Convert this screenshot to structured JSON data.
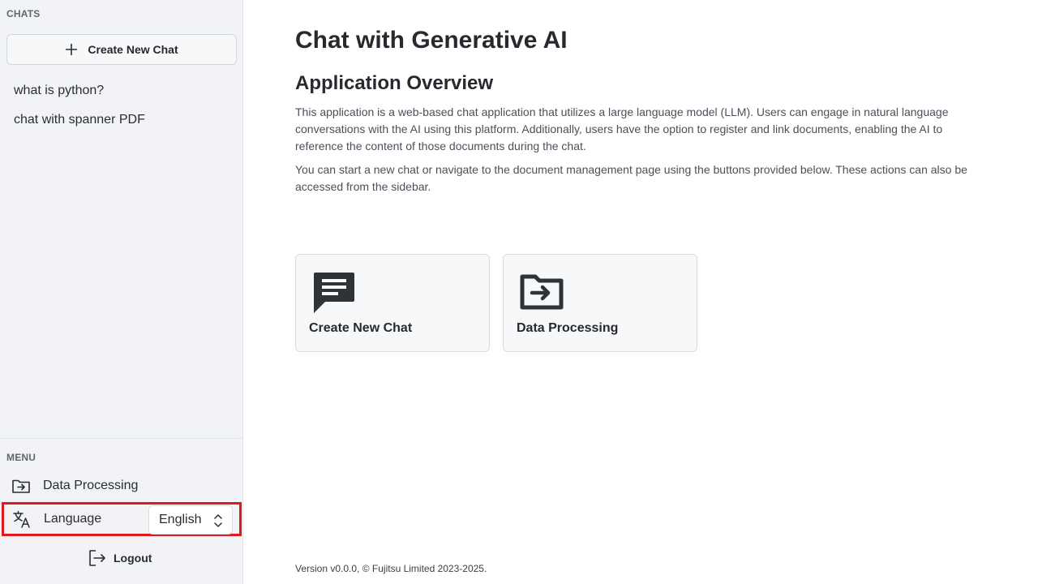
{
  "sidebar": {
    "chats_label": "CHATS",
    "new_chat_label": "Create New Chat",
    "chats": [
      {
        "title": "what is python?"
      },
      {
        "title": "chat with spanner PDF"
      }
    ],
    "menu_label": "MENU",
    "menu": {
      "data_processing_label": "Data Processing",
      "language_label": "Language",
      "language_value": "English",
      "logout_label": "Logout"
    }
  },
  "main": {
    "title": "Chat with Generative AI",
    "overview_title": "Application Overview",
    "paragraph1": "This application is a web-based chat application that utilizes a large language model (LLM). Users can engage in natural language conversations with the AI using this platform. Additionally, users have the option to register and link documents, enabling the AI to reference the content of those documents during the chat.",
    "paragraph2": "You can start a new chat or navigate to the document management page using the buttons provided below. These actions can also be accessed from the sidebar.",
    "cards": [
      {
        "label": "Create New Chat",
        "icon": "chat-icon"
      },
      {
        "label": "Data Processing",
        "icon": "folder-arrow-icon"
      }
    ]
  },
  "footer": {
    "version": "Version v0.0.0, © Fujitsu Limited 2023-2025."
  },
  "colors": {
    "sidebar_bg": "#f1f3f6",
    "highlight_border": "#e0191e",
    "text": "#24272b",
    "card_bg": "#f7f8fa"
  }
}
